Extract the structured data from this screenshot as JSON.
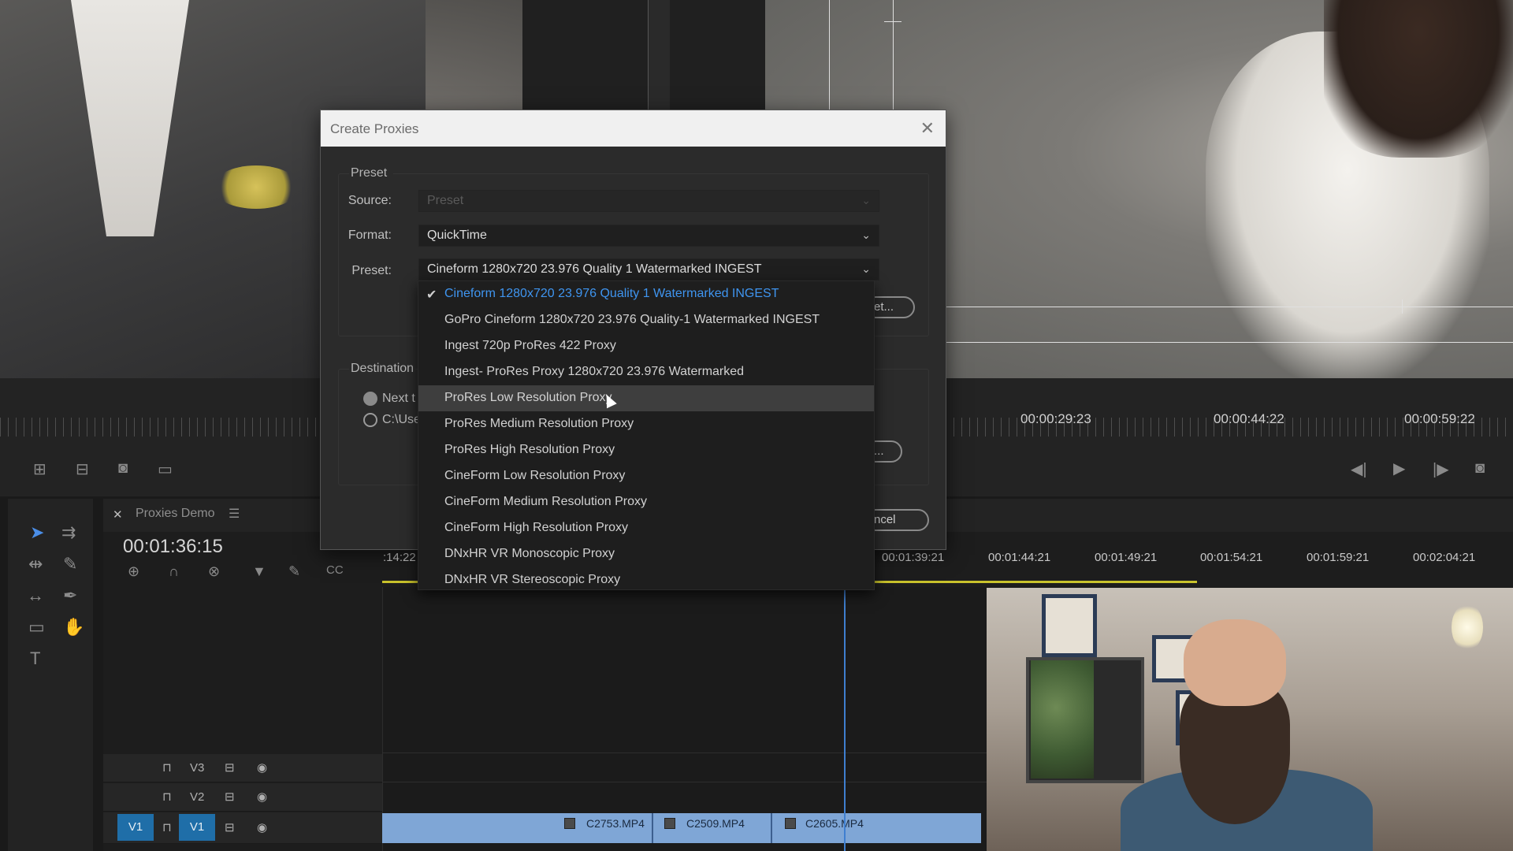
{
  "dialog": {
    "title": "Create Proxies",
    "preset_section": "Preset",
    "source_label": "Source:",
    "source_value": "Preset",
    "format_label": "Format:",
    "format_value": "QuickTime",
    "preset_label": "Preset:",
    "preset_value": "Cineform 1280x720 23.976 Quality 1 Watermarked INGEST",
    "ingest_button_partial": "et...",
    "destination_section": "Destination",
    "radio_next_partial": "Next t",
    "radio_path_partial": "C:\\Use",
    "browse_button_partial": "...",
    "cancel_button_partial": "ncel"
  },
  "preset_options": [
    "Cineform 1280x720 23.976 Quality 1 Watermarked INGEST",
    "GoPro Cineform 1280x720 23.976 Quality-1 Watermarked INGEST",
    "Ingest 720p ProRes 422 Proxy",
    "Ingest- ProRes Proxy 1280x720 23.976 Watermarked",
    "ProRes Low Resolution Proxy",
    "ProRes Medium Resolution Proxy",
    "ProRes High Resolution Proxy",
    "CineForm Low Resolution Proxy",
    "CineForm Medium Resolution Proxy",
    "CineForm High Resolution Proxy",
    "DNxHR VR Monoscopic Proxy",
    "DNxHR VR Stereoscopic Proxy"
  ],
  "selected_option_index": 0,
  "hovered_option_index": 4,
  "monitor": {
    "timecodes": [
      "00:00:29:23",
      "00:00:44:22",
      "00:00:59:22"
    ]
  },
  "timeline": {
    "sequence_name": "Proxies Demo",
    "current_timecode": "00:01:36:15",
    "ruler_partial": ":14:22",
    "ruler_timecodes": [
      "00:01:39:21",
      "00:01:44:21",
      "00:01:49:21",
      "00:01:54:21",
      "00:01:59:21",
      "00:02:04:21"
    ],
    "tracks": [
      "V3",
      "V2",
      "V1"
    ],
    "source_track": "V1",
    "clips": [
      "C2753.MP4",
      "C2509.MP4",
      "C2605.MP4"
    ]
  },
  "colors": {
    "accent_blue": "#3f95f0",
    "clip_blue": "#7fa6d6",
    "work_area_yellow": "#c9c22c"
  }
}
